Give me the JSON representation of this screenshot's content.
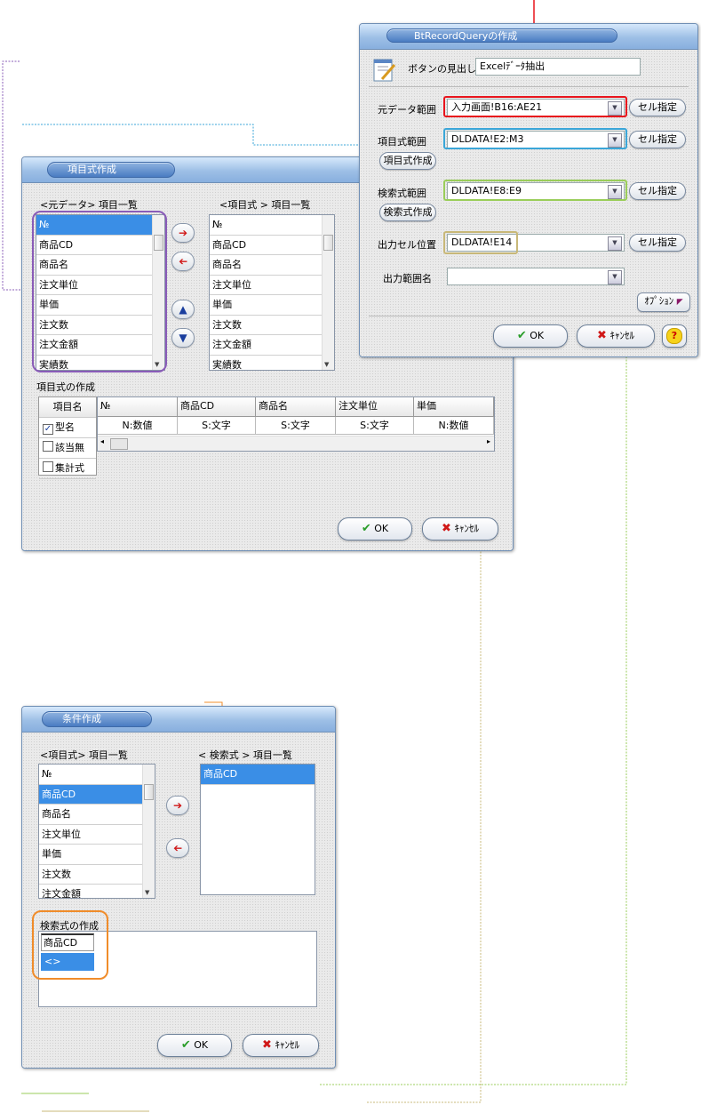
{
  "btrq": {
    "title": "BtRecordQueryの作成",
    "caption_label": "ボタンの見出し",
    "caption_value": "Excelﾃﾞｰﾀ抽出",
    "rows": [
      {
        "label": "元データ範囲",
        "value": "入力画面!B16:AE21",
        "button": "セル指定"
      },
      {
        "label": "項目式範囲",
        "value": "DLDATA!E2:M3",
        "button": "セル指定",
        "sub_button": "項目式作成"
      },
      {
        "label": "検索式範囲",
        "value": "DLDATA!E8:E9",
        "button": "セル指定",
        "sub_button": "検索式作成"
      },
      {
        "label": "出力セル位置",
        "value": "DLDATA!E14",
        "button": "セル指定"
      },
      {
        "label": "出力範囲名",
        "value": ""
      }
    ],
    "option_label": "ｵﾌﾟｼｮﾝ",
    "ok_label": "OK",
    "cancel_label": "ｷｬﾝｾﾙ",
    "help_label": "?"
  },
  "kmk": {
    "title": "項目式作成",
    "src_header": "<元データ> 項目一覧",
    "dst_header": "<項目式 > 項目一覧",
    "src_items": [
      "№",
      "商品CD",
      "商品名",
      "注文単位",
      "単価",
      "注文数",
      "注文金額",
      "実績数"
    ],
    "dst_items": [
      "№",
      "商品CD",
      "商品名",
      "注文単位",
      "単価",
      "注文数",
      "注文金額",
      "実績数"
    ],
    "builder_label": "項目式の作成",
    "side_header": "項目名",
    "side_options": [
      {
        "label": "型名",
        "checked": true
      },
      {
        "label": "該当無",
        "checked": false
      },
      {
        "label": "集計式",
        "checked": false
      }
    ],
    "grid_headers": [
      "№",
      "商品CD",
      "商品名",
      "注文単位",
      "単価"
    ],
    "grid_values": [
      "N:数値",
      "S:文字",
      "S:文字",
      "S:文字",
      "N:数値"
    ],
    "ok_label": "OK",
    "cancel_label": "ｷｬﾝｾﾙ"
  },
  "jkn": {
    "title": "条件作成",
    "src_header": "<項目式> 項目一覧",
    "dst_header": "< 検索式 > 項目一覧",
    "src_items": [
      "№",
      "商品CD",
      "商品名",
      "注文単位",
      "単価",
      "注文数",
      "注文金額"
    ],
    "dst_items": [
      "商品CD"
    ],
    "builder_label": "検索式の作成",
    "cond_header": "商品CD",
    "cond_value": "<>",
    "ok_label": "OK",
    "cancel_label": "ｷｬﾝｾﾙ"
  },
  "colors": {
    "red": "#e8141c",
    "blue": "#3aa6d8",
    "green": "#9acd5a",
    "olive": "#c8b878",
    "purple": "#8a5cb8",
    "orange": "#f08c2a",
    "selection": "#3a8ee6"
  }
}
